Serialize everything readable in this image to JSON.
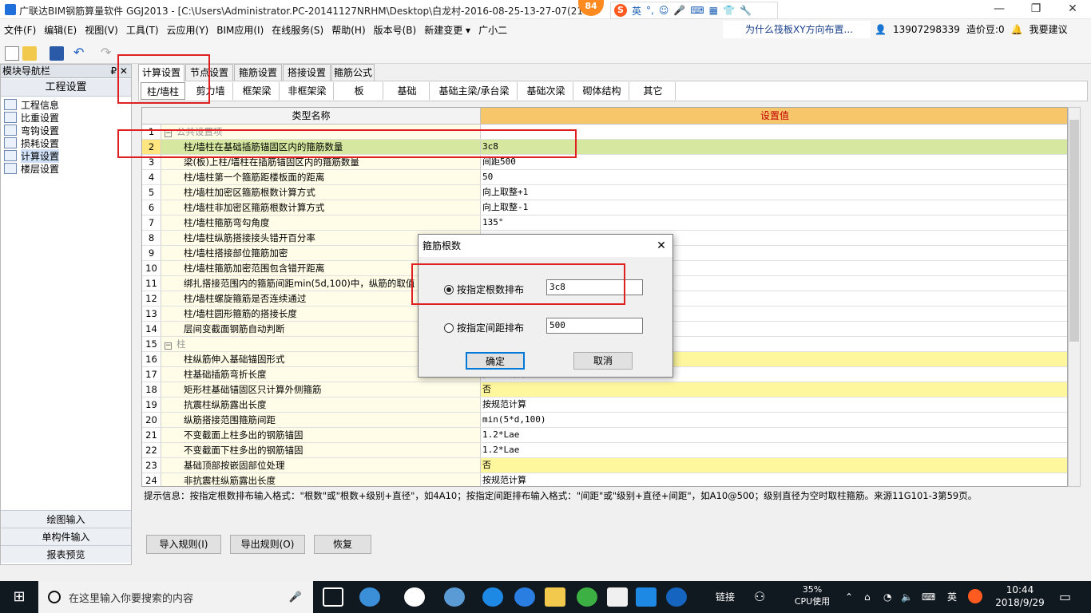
{
  "window": {
    "title": "广联达BIM钢筋算量软件 GGJ2013 - [C:\\Users\\Administrator.PC-20141127NRHM\\Desktop\\白龙村-2016-08-25-13-27-07(218...",
    "notification_count": "84",
    "ime_label": "英",
    "controls": {
      "minimize": "—",
      "maximize": "❐",
      "close": "✕"
    }
  },
  "menu": {
    "items": [
      "文件(F)",
      "编辑(E)",
      "视图(V)",
      "工具(T)",
      "云应用(Y)",
      "BIM应用(I)",
      "在线服务(S)",
      "帮助(H)",
      "版本号(B)",
      "新建变更 ▾",
      "广小二"
    ],
    "tip_link": "为什么筏板XY方向布置...",
    "phone": "13907298339",
    "points": "造价豆:0",
    "suggest": "我要建议"
  },
  "left_panel": {
    "title": "模块导航栏",
    "pin": "₽ ✕",
    "section": "工程设置",
    "tree": [
      "工程信息",
      "比重设置",
      "弯钩设置",
      "损耗设置",
      "计算设置",
      "楼层设置"
    ],
    "selected_index": 4,
    "bottom": [
      "绘图输入",
      "单构件输入",
      "报表预览"
    ]
  },
  "tabs": [
    "计算设置",
    "节点设置",
    "箍筋设置",
    "搭接设置",
    "箍筋公式"
  ],
  "subtabs": [
    "柱/墙柱",
    "剪力墙",
    "框架梁",
    "非框架梁",
    "板",
    "基础",
    "基础主梁/承台梁",
    "基础次梁",
    "砌体结构",
    "其它"
  ],
  "grid": {
    "headers": {
      "name": "类型名称",
      "value": "设置值"
    },
    "rows": [
      {
        "n": "1",
        "name": "公共设置项",
        "value": "",
        "group": true
      },
      {
        "n": "2",
        "name": "柱/墙柱在基础插筋锚固区内的箍筋数量",
        "value": "3c8",
        "sel": true
      },
      {
        "n": "3",
        "name": "梁(板)上柱/墙柱在插筋锚固区内的箍筋数量",
        "value": "间距500"
      },
      {
        "n": "4",
        "name": "柱/墙柱第一个箍筋距楼板面的距离",
        "value": "50"
      },
      {
        "n": "5",
        "name": "柱/墙柱加密区箍筋根数计算方式",
        "value": "向上取整+1"
      },
      {
        "n": "6",
        "name": "柱/墙柱非加密区箍筋根数计算方式",
        "value": "向上取整-1"
      },
      {
        "n": "7",
        "name": "柱/墙柱箍筋弯勾角度",
        "value": "135°"
      },
      {
        "n": "8",
        "name": "柱/墙柱纵筋搭接接头错开百分率",
        "value": ""
      },
      {
        "n": "9",
        "name": "柱/墙柱搭接部位箍筋加密",
        "value": ""
      },
      {
        "n": "10",
        "name": "柱/墙柱箍筋加密范围包含错开距离",
        "value": ""
      },
      {
        "n": "11",
        "name": "绑扎搭接范围内的箍筋间距min(5d,100)中，纵筋的取值",
        "value": ""
      },
      {
        "n": "12",
        "name": "柱/墙柱螺旋箍筋是否连续通过",
        "value": ""
      },
      {
        "n": "13",
        "name": "柱/墙柱圆形箍筋的搭接长度",
        "value": ""
      },
      {
        "n": "14",
        "name": "层间变截面钢筋自动判断",
        "value": ""
      },
      {
        "n": "15",
        "name": "柱",
        "value": "",
        "group": true
      },
      {
        "n": "16",
        "name": "柱纵筋伸入基础锚固形式",
        "value": "",
        "hl": true
      },
      {
        "n": "17",
        "name": "柱基础插筋弯折长度",
        "value": "按规范计算"
      },
      {
        "n": "18",
        "name": "矩形柱基础锚固区只计算外侧箍筋",
        "value": "否",
        "hl": true
      },
      {
        "n": "19",
        "name": "抗震柱纵筋露出长度",
        "value": "按规范计算"
      },
      {
        "n": "20",
        "name": "纵筋搭接范围箍筋间距",
        "value": "min(5*d,100)"
      },
      {
        "n": "21",
        "name": "不变截面上柱多出的钢筋锚固",
        "value": "1.2*Lae"
      },
      {
        "n": "22",
        "name": "不变截面下柱多出的钢筋锚固",
        "value": "1.2*Lae"
      },
      {
        "n": "23",
        "name": "基础顶部按嵌固部位处理",
        "value": "否",
        "hl": true
      },
      {
        "n": "24",
        "name": "非抗震柱纵筋露出长度",
        "value": "按规范计算"
      }
    ]
  },
  "hint": "提示信息：按指定根数排布输入格式：\"根数\"或\"根数+级别+直径\"，如4A10；按指定间距排布输入格式：\"间距\"或\"级别+直径+间距\"，如A10@500；级别直径为空时取柱箍筋。来源11G101-3第59页。",
  "buttons": {
    "import": "导入规则(I)",
    "export": "导出规则(O)",
    "restore": "恢复"
  },
  "dialog": {
    "title": "箍筋根数",
    "option1": "按指定根数排布",
    "value1": "3c8",
    "option2": "按指定间距排布",
    "value2": "500",
    "ok": "确定",
    "cancel": "取消"
  },
  "taskbar": {
    "search_placeholder": "在这里输入你要搜索的内容",
    "link": "链接",
    "cpu_pct": "35%",
    "cpu_label": "CPU使用",
    "lang": "英",
    "time": "10:44",
    "date": "2018/9/29"
  }
}
